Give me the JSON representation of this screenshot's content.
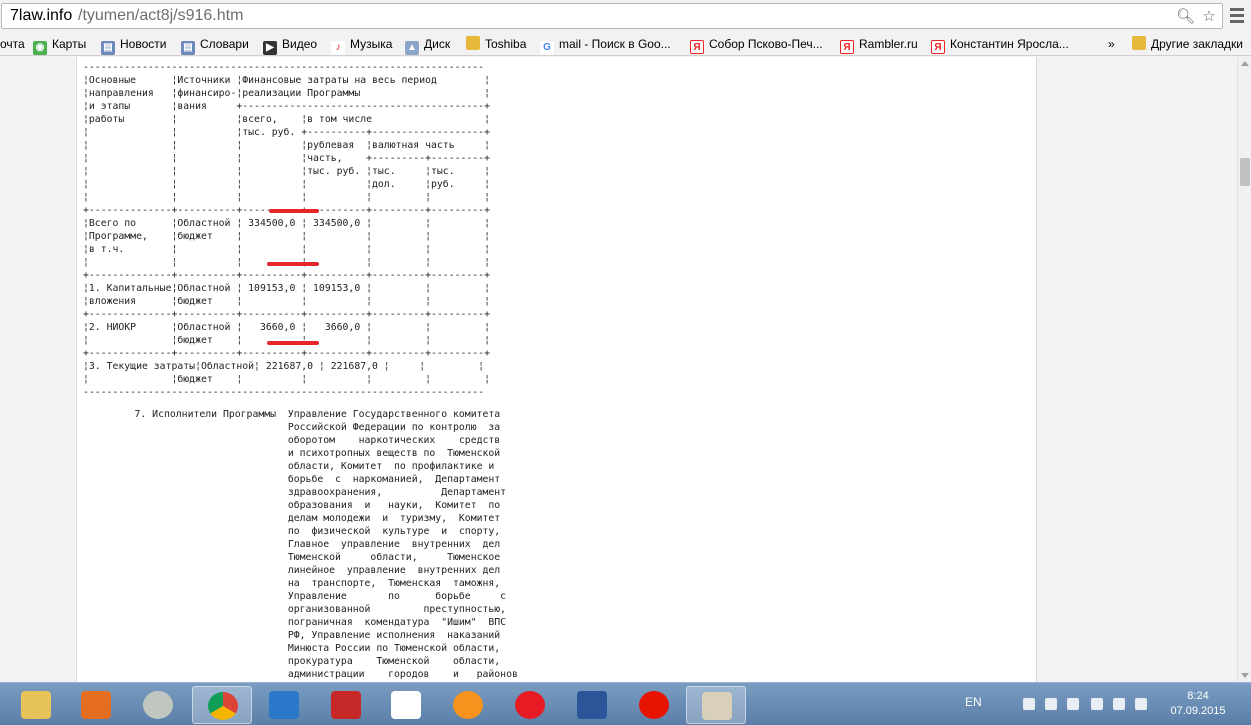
{
  "browser": {
    "url_host": "7law.info",
    "url_path": "/tyumen/act8j/s916.htm",
    "bookmarks": [
      {
        "label": "очта",
        "icon": "mail-icon"
      },
      {
        "label": "Карты",
        "icon": "maps-icon"
      },
      {
        "label": "Новости",
        "icon": "page-icon"
      },
      {
        "label": "Словари",
        "icon": "page-icon"
      },
      {
        "label": "Видео",
        "icon": "video-icon"
      },
      {
        "label": "Музыка",
        "icon": "music-icon"
      },
      {
        "label": "Диск",
        "icon": "disk-icon"
      },
      {
        "label": "Toshiba",
        "icon": "folder-icon"
      },
      {
        "label": "mail - Поиск в Goo...",
        "icon": "google-icon"
      },
      {
        "label": "Собор Псково-Печ...",
        "icon": "yandex-icon"
      },
      {
        "label": "Rambler.ru",
        "icon": "yandex-icon"
      },
      {
        "label": "Константин Яросла...",
        "icon": "yandex-icon"
      }
    ],
    "more_label": "»",
    "other_bookmarks": "Другие закладки"
  },
  "document": {
    "table_text": "--------------------------------------------------------------------\n¦Основные      ¦Источники ¦Финансовые затраты на весь период        ¦\n¦направления   ¦финансиро-¦реализации Программы                     ¦\n¦и этапы       ¦вания     +-----------------------------------------+\n¦работы        ¦          ¦всего,    ¦в том числе                   ¦\n¦              ¦          ¦тыс. руб. +----------+-------------------+\n¦              ¦          ¦          ¦рублевая  ¦валютная часть     ¦\n¦              ¦          ¦          ¦часть,    +---------+---------+\n¦              ¦          ¦          ¦тыс. руб. ¦тыс.     ¦тыс.     ¦\n¦              ¦          ¦          ¦          ¦дол.     ¦руб.     ¦\n¦              ¦          ¦          ¦          ¦         ¦         ¦\n+--------------+----------+----------+----------+---------+---------+\n¦Всего по      ¦Областной ¦ 334500,0 ¦ 334500,0 ¦         ¦         ¦\n¦Программе,    ¦бюджет    ¦          ¦          ¦         ¦         ¦\n¦в т.ч.        ¦          ¦          ¦          ¦         ¦         ¦\n¦              ¦          ¦          ¦          ¦         ¦         ¦\n+--------------+----------+----------+----------+---------+---------+\n¦1. Капитальные¦Областной ¦ 109153,0 ¦ 109153,0 ¦         ¦         ¦\n¦вложения      ¦бюджет    ¦          ¦          ¦         ¦         ¦\n+--------------+----------+----------+----------+---------+---------+\n¦2. НИОКР      ¦Областной ¦   3660,0 ¦   3660,0 ¦         ¦         ¦\n¦              ¦бюджет    ¦          ¦          ¦         ¦         ¦\n+--------------+----------+----------+----------+---------+---------+\n¦3. Текущие затраты¦Областной¦ 221687,0 ¦ 221687,0 ¦     ¦         ¦\n¦              ¦бюджет    ¦          ¦          ¦         ¦         ¦\n--------------------------------------------------------------------",
    "executors_text": "     7. Исполнители Программы  Управление Государственного комитета\n                               Российской Федерации по контролю  за\n                               оборотом    наркотических    средств\n                               и психотропных веществ по  Тюменской\n                               области, Комитет  по профилактике и\n                               борьбе  с  наркоманией,  Департамент\n                               здравоохранения,          Департамент\n                               образования  и   науки,  Комитет  по\n                               делам молодежи  и  туризму,  Комитет\n                               по  физической  культуре  и  спорту,\n                               Главное  управление  внутренних  дел\n                               Тюменской     области,     Тюменское\n                               линейное  управление  внутренних дел\n                               на  транспорте,  Тюменская  таможня,\n                               Управление       по      борьбе     с\n                               организованной         преступностью,\n                               пограничная  комендатура  \"Ишим\"  ВПС\n                               РФ, Управление исполнения  наказаний\n                               Минюста России по Тюменской области,\n                               прокуратура    Тюменской    области,\n                               администрации    городов    и   районов"
  },
  "taskbar": {
    "apps": [
      "explorer-icon",
      "media-player-icon",
      "app-icon",
      "chrome-icon",
      "mail-icon",
      "kaspersky-icon",
      "yandex-icon",
      "ok-icon",
      "opera-icon",
      "word-icon",
      "yandex-browser-icon",
      "paint-icon"
    ],
    "lang": "EN",
    "time": "8:24",
    "date": "07.09.2015"
  }
}
